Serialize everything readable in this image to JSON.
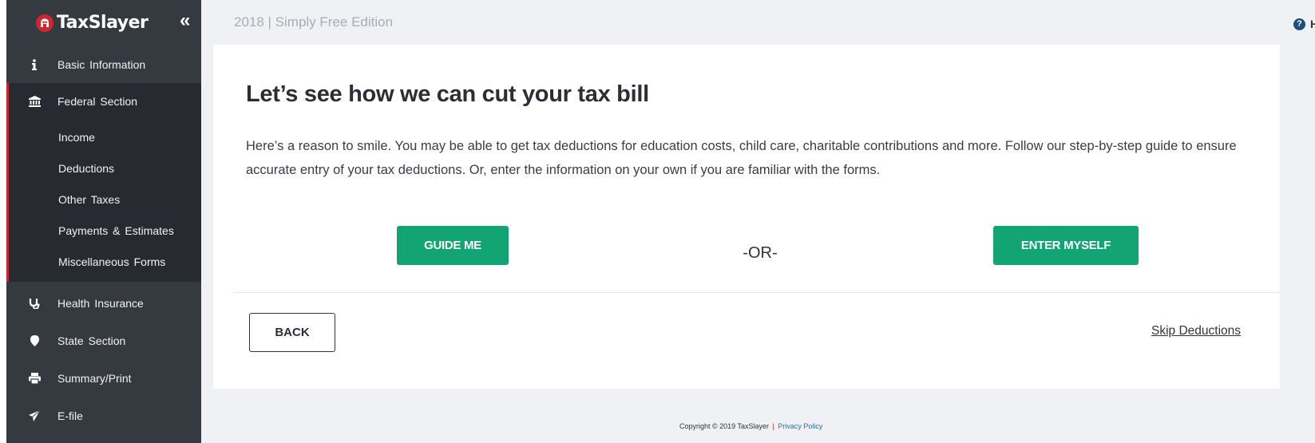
{
  "app": {
    "brand": "TaxSlayer",
    "edition_title": "2018 | Simply Free Edition",
    "help_label": "H"
  },
  "sidebar": {
    "collapse_icon": "double-chevron-left",
    "items": [
      {
        "label": "Basic Information",
        "icon": "info-icon"
      },
      {
        "label": "Federal Section",
        "icon": "bank-icon",
        "active": true,
        "children": [
          {
            "label": "Income"
          },
          {
            "label": "Deductions"
          },
          {
            "label": "Other Taxes"
          },
          {
            "label": "Payments & Estimates"
          },
          {
            "label": "Miscellaneous Forms"
          }
        ]
      },
      {
        "label": "Health Insurance",
        "icon": "stethoscope-icon"
      },
      {
        "label": "State Section",
        "icon": "map-marker-icon"
      },
      {
        "label": "Summary/Print",
        "icon": "print-icon"
      },
      {
        "label": "E-file",
        "icon": "paper-plane-icon"
      }
    ]
  },
  "main": {
    "heading": "Let’s see how we can cut your tax bill",
    "paragraph": "Here’s a reason to smile. You may be able to get tax deductions for education costs, child care, charitable contributions and more. Follow our step-by-step guide to ensure accurate entry of your tax deductions. Or, enter the information on your own if you are familiar with the forms.",
    "guide_button": "GUIDE ME",
    "or_label": "-OR-",
    "enter_button": "ENTER MYSELF",
    "back_button": "BACK",
    "skip_link": "Skip Deductions"
  },
  "footer": {
    "copyright": "Copyright © 2019 TaxSlayer",
    "separator": "|",
    "privacy_link": "Privacy Policy"
  },
  "colors": {
    "sidebar_bg": "#353940",
    "active_section_bg": "#272a30",
    "active_accent": "#c4262e",
    "primary_button": "#12a473",
    "page_bg": "#f0f1f5"
  }
}
